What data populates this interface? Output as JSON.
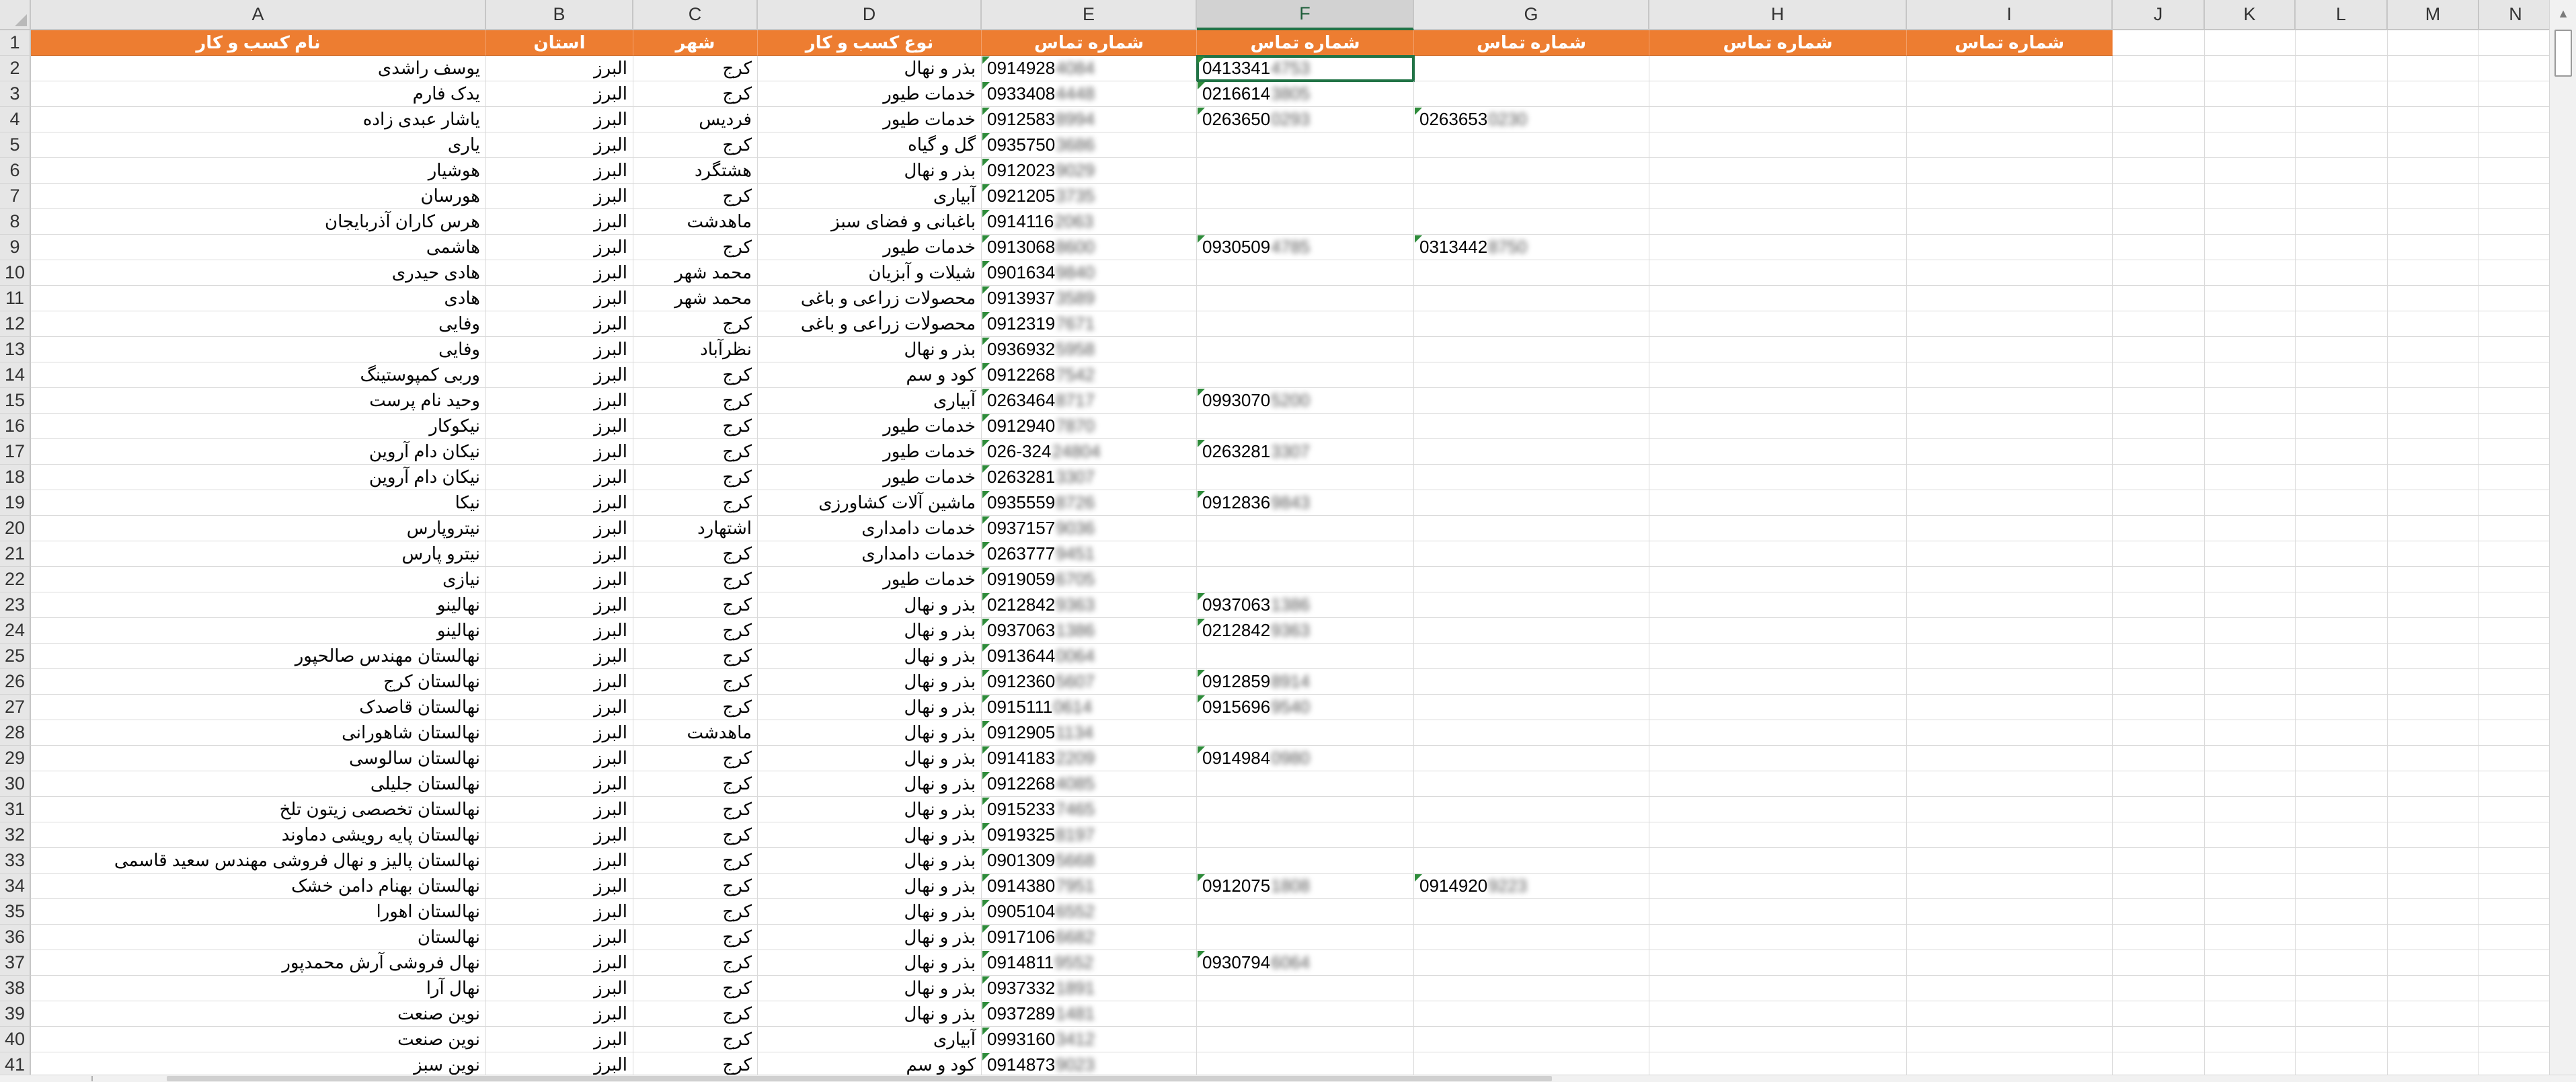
{
  "columns": [
    "A",
    "B",
    "C",
    "D",
    "E",
    "F",
    "G",
    "H",
    "I",
    "J",
    "K",
    "L",
    "M",
    "N"
  ],
  "selected_column": "F",
  "header_row": {
    "A": "نام کسب و کار",
    "B": "استان",
    "C": "شهر",
    "D": "نوع کسب و کار",
    "E": "شماره تماس",
    "F": "شماره تماس",
    "G": "شماره تماس",
    "H": "شماره تماس",
    "I": "شماره تماس"
  },
  "rows": [
    {
      "n": "2",
      "A": "یوسف راشدی",
      "B": "البرز",
      "C": "کرج",
      "D": "بذر و نهال",
      "E": "0914928",
      "Eb": "4084",
      "F": "0413341",
      "Fb": "4753",
      "G": "",
      "Gb": ""
    },
    {
      "n": "3",
      "A": "یدک فارم",
      "B": "البرز",
      "C": "کرج",
      "D": "خدمات طیور",
      "E": "0933408",
      "Eb": "4448",
      "F": "0216614",
      "Fb": "3805",
      "G": "",
      "Gb": ""
    },
    {
      "n": "4",
      "A": "یاشار عبدی زاده",
      "B": "البرز",
      "C": "فردیس",
      "D": "خدمات طیور",
      "E": "0912583",
      "Eb": "8994",
      "F": "0263650",
      "Fb": "0293",
      "G": "0263653",
      "Gb": "0230"
    },
    {
      "n": "5",
      "A": "یاری",
      "B": "البرز",
      "C": "کرج",
      "D": "گل و گیاه",
      "E": "0935750",
      "Eb": "3686",
      "F": "",
      "Fb": "",
      "G": "",
      "Gb": ""
    },
    {
      "n": "6",
      "A": "هوشیار",
      "B": "البرز",
      "C": "هشتگرد",
      "D": "بذر و نهال",
      "E": "0912023",
      "Eb": "9029",
      "F": "",
      "Fb": "",
      "G": "",
      "Gb": ""
    },
    {
      "n": "7",
      "A": "هورسان",
      "B": "البرز",
      "C": "کرج",
      "D": "آبیاری",
      "E": "0921205",
      "Eb": "3735",
      "F": "",
      "Fb": "",
      "G": "",
      "Gb": ""
    },
    {
      "n": "8",
      "A": "هرس کاران آذربایجان",
      "B": "البرز",
      "C": "ماهدشت",
      "D": "باغبانی و فضای سبز",
      "E": "0914116",
      "Eb": "2063",
      "F": "",
      "Fb": "",
      "G": "",
      "Gb": ""
    },
    {
      "n": "9",
      "A": "هاشمی",
      "B": "البرز",
      "C": "کرج",
      "D": "خدمات طیور",
      "E": "0913068",
      "Eb": "8600",
      "F": "0930509",
      "Fb": "4785",
      "G": "0313442",
      "Gb": "8750"
    },
    {
      "n": "10",
      "A": "هادی حیدری",
      "B": "البرز",
      "C": "محمد شهر",
      "D": "شیلات و آبزیان",
      "E": "0901634",
      "Eb": "9840",
      "F": "",
      "Fb": "",
      "G": "",
      "Gb": ""
    },
    {
      "n": "11",
      "A": "هادی",
      "B": "البرز",
      "C": "محمد شهر",
      "D": "محصولات زراعی و باغی",
      "E": "0913937",
      "Eb": "3589",
      "F": "",
      "Fb": "",
      "G": "",
      "Gb": ""
    },
    {
      "n": "12",
      "A": "وفایی",
      "B": "البرز",
      "C": "کرج",
      "D": "محصولات زراعی و باغی",
      "E": "0912319",
      "Eb": "7671",
      "F": "",
      "Fb": "",
      "G": "",
      "Gb": ""
    },
    {
      "n": "13",
      "A": "وفایی",
      "B": "البرز",
      "C": "نظرآباد",
      "D": "بذر و نهال",
      "E": "0936932",
      "Eb": "5958",
      "F": "",
      "Fb": "",
      "G": "",
      "Gb": ""
    },
    {
      "n": "14",
      "A": "وربی کمپوستینگ",
      "B": "البرز",
      "C": "کرج",
      "D": "کود و سم",
      "E": "0912268",
      "Eb": "7542",
      "F": "",
      "Fb": "",
      "G": "",
      "Gb": ""
    },
    {
      "n": "15",
      "A": "وحید نام پرست",
      "B": "البرز",
      "C": "کرج",
      "D": "آبیاری",
      "E": "0263464",
      "Eb": "8717",
      "F": "0993070",
      "Fb": "5200",
      "G": "",
      "Gb": ""
    },
    {
      "n": "16",
      "A": "نیکوکار",
      "B": "البرز",
      "C": "کرج",
      "D": "خدمات طیور",
      "E": "0912940",
      "Eb": "7870",
      "F": "",
      "Fb": "",
      "G": "",
      "Gb": ""
    },
    {
      "n": "17",
      "A": "نیکان دام آروین",
      "B": "البرز",
      "C": "کرج",
      "D": "خدمات طیور",
      "E": "026-324",
      "Eb": "24804",
      "F": "0263281",
      "Fb": "3307",
      "G": "",
      "Gb": ""
    },
    {
      "n": "18",
      "A": "نیکان دام آروین",
      "B": "البرز",
      "C": "کرج",
      "D": "خدمات طیور",
      "E": "0263281",
      "Eb": "3307",
      "F": "",
      "Fb": "",
      "G": "",
      "Gb": ""
    },
    {
      "n": "19",
      "A": "نیکا",
      "B": "البرز",
      "C": "کرج",
      "D": "ماشین آلات کشاورزی",
      "E": "0935559",
      "Eb": "8726",
      "F": "0912836",
      "Fb": "9843",
      "G": "",
      "Gb": ""
    },
    {
      "n": "20",
      "A": "نیتروپارس",
      "B": "البرز",
      "C": "اشتهارد",
      "D": "خدمات دامداری",
      "E": "0937157",
      "Eb": "9036",
      "F": "",
      "Fb": "",
      "G": "",
      "Gb": ""
    },
    {
      "n": "21",
      "A": "نیترو پارس",
      "B": "البرز",
      "C": "کرج",
      "D": "خدمات دامداری",
      "E": "0263777",
      "Eb": "9451",
      "F": "",
      "Fb": "",
      "G": "",
      "Gb": ""
    },
    {
      "n": "22",
      "A": "نیازی",
      "B": "البرز",
      "C": "کرج",
      "D": "خدمات طیور",
      "E": "0919059",
      "Eb": "6705",
      "F": "",
      "Fb": "",
      "G": "",
      "Gb": ""
    },
    {
      "n": "23",
      "A": "نهالینو",
      "B": "البرز",
      "C": "کرج",
      "D": "بذر و نهال",
      "E": "0212842",
      "Eb": "9363",
      "F": "0937063",
      "Fb": "1386",
      "G": "",
      "Gb": ""
    },
    {
      "n": "24",
      "A": "نهالینو",
      "B": "البرز",
      "C": "کرج",
      "D": "بذر و نهال",
      "E": "0937063",
      "Eb": "1386",
      "F": "0212842",
      "Fb": "9363",
      "G": "",
      "Gb": ""
    },
    {
      "n": "25",
      "A": "نهالستان مهندس صالحپور",
      "B": "البرز",
      "C": "کرج",
      "D": "بذر و نهال",
      "E": "0913644",
      "Eb": "0064",
      "F": "",
      "Fb": "",
      "G": "",
      "Gb": ""
    },
    {
      "n": "26",
      "A": "نهالستان کرج",
      "B": "البرز",
      "C": "کرج",
      "D": "بذر و نهال",
      "E": "0912360",
      "Eb": "5607",
      "F": "0912859",
      "Fb": "8914",
      "G": "",
      "Gb": ""
    },
    {
      "n": "27",
      "A": "نهالستان قاصدک",
      "B": "البرز",
      "C": "کرج",
      "D": "بذر و نهال",
      "E": "0915111",
      "Eb": "0614",
      "F": "0915696",
      "Fb": "9540",
      "G": "",
      "Gb": ""
    },
    {
      "n": "28",
      "A": "نهالستان شاهورانی",
      "B": "البرز",
      "C": "ماهدشت",
      "D": "بذر و نهال",
      "E": "0912905",
      "Eb": "1134",
      "F": "",
      "Fb": "",
      "G": "",
      "Gb": ""
    },
    {
      "n": "29",
      "A": "نهالستان سالوسی",
      "B": "البرز",
      "C": "کرج",
      "D": "بذر و نهال",
      "E": "0914183",
      "Eb": "2209",
      "F": "0914984",
      "Fb": "0980",
      "G": "",
      "Gb": ""
    },
    {
      "n": "30",
      "A": "نهالستان جلیلی",
      "B": "البرز",
      "C": "کرج",
      "D": "بذر و نهال",
      "E": "0912268",
      "Eb": "4085",
      "F": "",
      "Fb": "",
      "G": "",
      "Gb": ""
    },
    {
      "n": "31",
      "A": "نهالستان تخصصی زیتون تلخ",
      "B": "البرز",
      "C": "کرج",
      "D": "بذر و نهال",
      "E": "0915233",
      "Eb": "7465",
      "F": "",
      "Fb": "",
      "G": "",
      "Gb": ""
    },
    {
      "n": "32",
      "A": "نهالستان پایه رویشی دماوند",
      "B": "البرز",
      "C": "کرج",
      "D": "بذر و نهال",
      "E": "0919325",
      "Eb": "8197",
      "F": "",
      "Fb": "",
      "G": "",
      "Gb": ""
    },
    {
      "n": "33",
      "A": "نهالستان پالیز و نهال فروشی مهندس سعید قاسمی",
      "B": "البرز",
      "C": "کرج",
      "D": "بذر و نهال",
      "E": "0901309",
      "Eb": "5668",
      "F": "",
      "Fb": "",
      "G": "",
      "Gb": ""
    },
    {
      "n": "34",
      "A": "نهالستان بهنام دامن خشک",
      "B": "البرز",
      "C": "کرج",
      "D": "بذر و نهال",
      "E": "0914380",
      "Eb": "7951",
      "F": "0912075",
      "Fb": "1808",
      "G": "0914920",
      "Gb": "9223"
    },
    {
      "n": "35",
      "A": "نهالستان اهورا",
      "B": "البرز",
      "C": "کرج",
      "D": "بذر و نهال",
      "E": "0905104",
      "Eb": "6552",
      "F": "",
      "Fb": "",
      "G": "",
      "Gb": ""
    },
    {
      "n": "36",
      "A": "نهالستان",
      "B": "البرز",
      "C": "کرج",
      "D": "بذر و نهال",
      "E": "0917106",
      "Eb": "6682",
      "F": "",
      "Fb": "",
      "G": "",
      "Gb": ""
    },
    {
      "n": "37",
      "A": "نهال فروشی آرش محمدپور",
      "B": "البرز",
      "C": "کرج",
      "D": "بذر و نهال",
      "E": "0914811",
      "Eb": "9552",
      "F": "0930794",
      "Fb": "6064",
      "G": "",
      "Gb": ""
    },
    {
      "n": "38",
      "A": "نهال آرا",
      "B": "البرز",
      "C": "کرج",
      "D": "بذر و نهال",
      "E": "0937332",
      "Eb": "1891",
      "F": "",
      "Fb": "",
      "G": "",
      "Gb": ""
    },
    {
      "n": "39",
      "A": "نوین صنعت",
      "B": "البرز",
      "C": "کرج",
      "D": "بذر و نهال",
      "E": "0937289",
      "Eb": "1481",
      "F": "",
      "Fb": "",
      "G": "",
      "Gb": ""
    },
    {
      "n": "40",
      "A": "نوین صنعت",
      "B": "البرز",
      "C": "کرج",
      "D": "آبیاری",
      "E": "0993160",
      "Eb": "3412",
      "F": "",
      "Fb": "",
      "G": "",
      "Gb": ""
    },
    {
      "n": "41",
      "A": "نوین سبز",
      "B": "البرز",
      "C": "کرج",
      "D": "کود و سم",
      "E": "0914873",
      "Eb": "9023",
      "F": "",
      "Fb": "",
      "G": "",
      "Gb": ""
    }
  ],
  "header_row_number": "1",
  "scroll_up_icon": "triangle-up-icon",
  "scroll_down_icon": "triangle-down-icon"
}
